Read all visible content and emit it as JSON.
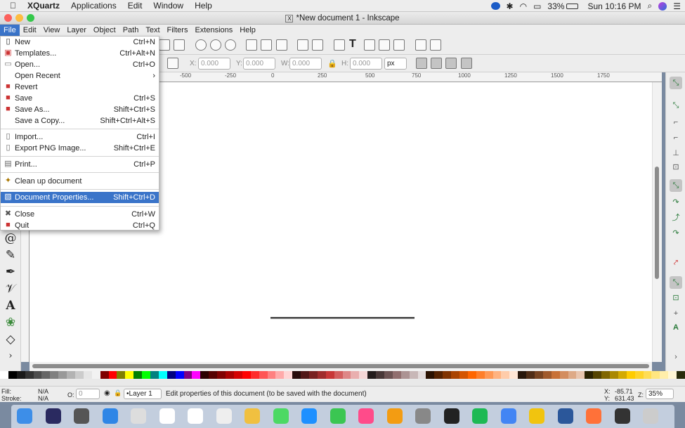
{
  "macmenu": {
    "apple": "",
    "app_name": "XQuartz",
    "items": [
      "Applications",
      "Edit",
      "Window",
      "Help"
    ],
    "battery": "33%",
    "clock": "Sun 10:16 PM"
  },
  "window": {
    "title": "*New document 1 - Inkscape",
    "title_icon": "X"
  },
  "menubar": [
    "File",
    "Edit",
    "View",
    "Layer",
    "Object",
    "Path",
    "Text",
    "Filters",
    "Extensions",
    "Help"
  ],
  "controls": {
    "x_label": "X:",
    "x_value": "0.000",
    "y_label": "Y:",
    "y_value": "0.000",
    "w_label": "W:",
    "w_value": "0.000",
    "h_label": "H:",
    "h_value": "0.000",
    "unit": "px"
  },
  "ruler_ticks": [
    "-500",
    "-250",
    "0",
    "250",
    "500",
    "750",
    "1000",
    "1250",
    "1500",
    "1750"
  ],
  "file_menu": [
    {
      "label": "New",
      "shortcut": "Ctrl+N",
      "icon": "new-document-icon"
    },
    {
      "label": "Templates...",
      "shortcut": "Ctrl+Alt+N",
      "icon": "templates-icon"
    },
    {
      "label": "Open...",
      "shortcut": "Ctrl+O",
      "icon": "open-folder-icon"
    },
    {
      "label": "Open Recent",
      "shortcut": "",
      "icon": "",
      "submenu": "›"
    },
    {
      "label": "Revert",
      "shortcut": "",
      "icon": "revert-icon"
    },
    {
      "label": "Save",
      "shortcut": "Ctrl+S",
      "icon": "save-icon"
    },
    {
      "label": "Save As...",
      "shortcut": "Shift+Ctrl+S",
      "icon": "save-as-icon"
    },
    {
      "label": "Save a Copy...",
      "shortcut": "Shift+Ctrl+Alt+S",
      "icon": ""
    },
    {
      "label": "Import...",
      "shortcut": "Ctrl+I",
      "icon": "import-icon"
    },
    {
      "label": "Export PNG Image...",
      "shortcut": "Shift+Ctrl+E",
      "icon": "export-icon"
    },
    {
      "label": "Print...",
      "shortcut": "Ctrl+P",
      "icon": "print-icon"
    },
    {
      "label": "Clean up document",
      "shortcut": "",
      "icon": "clean-up-icon"
    },
    {
      "label": "Document Properties...",
      "shortcut": "Shift+Ctrl+D",
      "icon": "document-properties-icon",
      "highlighted": true
    },
    {
      "label": "Close",
      "shortcut": "Ctrl+W",
      "icon": "close-icon"
    },
    {
      "label": "Quit",
      "shortcut": "Ctrl+Q",
      "icon": "quit-icon"
    }
  ],
  "status": {
    "fill_label": "Fill:",
    "fill_value": "N/A",
    "stroke_label": "Stroke:",
    "stroke_value": "N/A",
    "opacity_label": "O:",
    "opacity_value": "0",
    "layer": "•Layer 1",
    "message": "Edit properties of this document (to be saved with the document)",
    "x_label": "X:",
    "x_value": "-85.71",
    "y_label": "Y:",
    "y_value": "631.43",
    "zoom_label": "Z:",
    "zoom_value": "35%"
  },
  "colors": {
    "accent": "#3a74c9",
    "menu_highlight": "#3a74c9"
  },
  "dock_icons": [
    "finder",
    "siri",
    "launchpad",
    "safari",
    "preview",
    "calendar",
    "notes",
    "reminders",
    "photos",
    "messages",
    "app-store",
    "facetime",
    "itunes",
    "ibooks",
    "system-preferences",
    "inkscape",
    "spotify",
    "chrome",
    "fotor",
    "word",
    "firefox",
    "xquartz",
    "trash"
  ]
}
